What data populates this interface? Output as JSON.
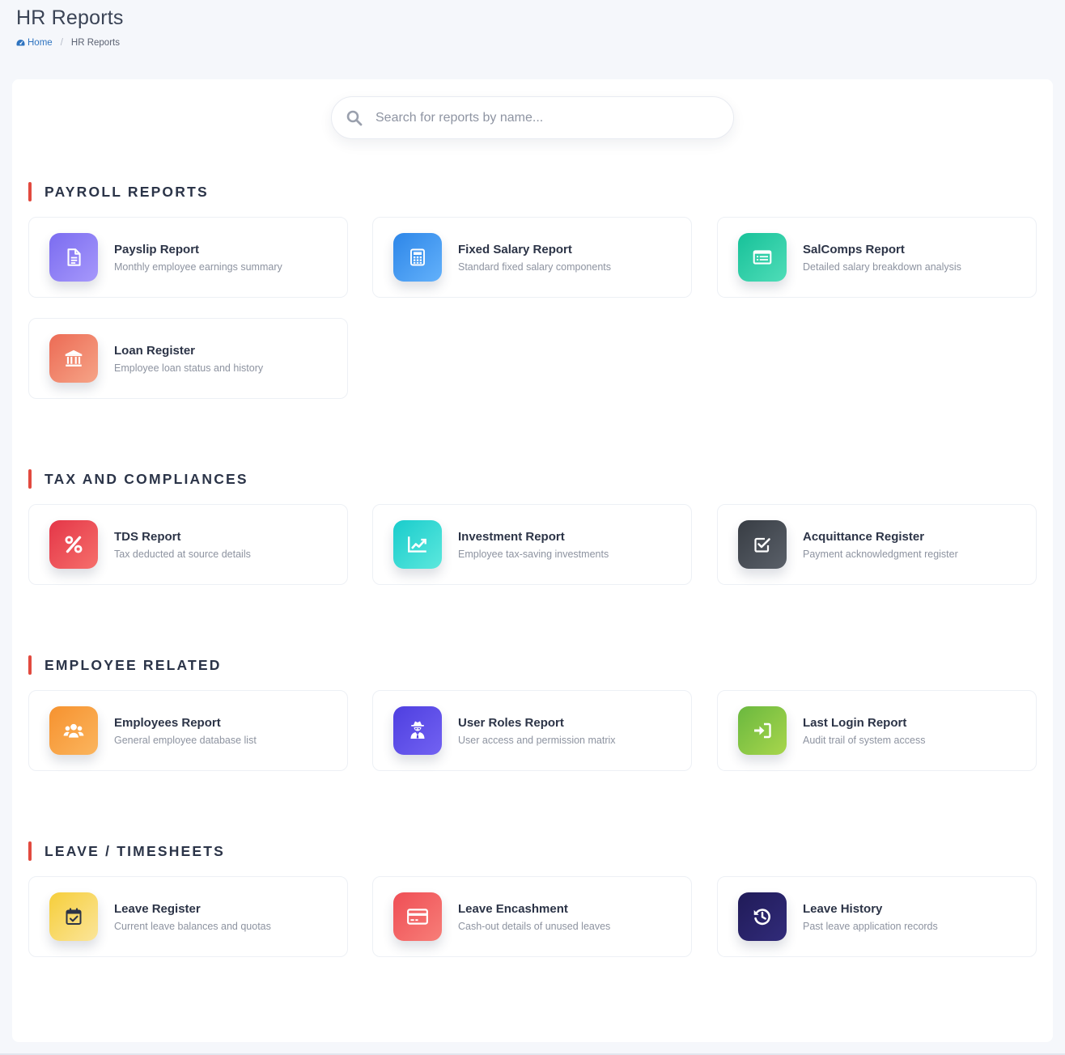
{
  "page": {
    "title": "HR Reports",
    "breadcrumb": {
      "home": "Home",
      "separator": "/",
      "current": "HR Reports"
    }
  },
  "search": {
    "placeholder": "Search for reports by name...",
    "value": ""
  },
  "colors": {
    "accent": "#e24a3f",
    "link": "#2f74c0"
  },
  "sections": [
    {
      "title": "PAYROLL REPORTS",
      "cards": [
        {
          "title": "Payslip Report",
          "desc": "Monthly employee earnings summary",
          "icon": "file-icon",
          "gradient": [
            "#7b6cf0",
            "#a698fb"
          ]
        },
        {
          "title": "Fixed Salary Report",
          "desc": "Standard fixed salary components",
          "icon": "calculator-icon",
          "gradient": [
            "#2d86e8",
            "#63b1fb"
          ]
        },
        {
          "title": "SalComps Report",
          "desc": "Detailed salary breakdown analysis",
          "icon": "list-card-icon",
          "gradient": [
            "#17c199",
            "#4fddb8"
          ]
        },
        {
          "title": "Loan Register",
          "desc": "Employee loan status and history",
          "icon": "bank-icon",
          "gradient": [
            "#ec6b55",
            "#f6a487"
          ]
        }
      ]
    },
    {
      "title": "TAX AND COMPLIANCES",
      "cards": [
        {
          "title": "TDS Report",
          "desc": "Tax deducted at source details",
          "icon": "percent-icon",
          "gradient": [
            "#e43648",
            "#f66f6b"
          ]
        },
        {
          "title": "Investment Report",
          "desc": "Employee tax-saving investments",
          "icon": "chart-line-icon",
          "gradient": [
            "#19cccc",
            "#5ce8dd"
          ]
        },
        {
          "title": "Acquittance Register",
          "desc": "Payment acknowledgment register",
          "icon": "check-square-icon",
          "gradient": [
            "#383d44",
            "#5a6069"
          ]
        }
      ]
    },
    {
      "title": "EMPLOYEE RELATED",
      "cards": [
        {
          "title": "Employees Report",
          "desc": "General employee database list",
          "icon": "users-icon",
          "gradient": [
            "#f6922f",
            "#fbb55e"
          ]
        },
        {
          "title": "User Roles Report",
          "desc": "User access and permission matrix",
          "icon": "user-secret-icon",
          "gradient": [
            "#4e3fe0",
            "#7262f2"
          ]
        },
        {
          "title": "Last Login Report",
          "desc": "Audit trail of system access",
          "icon": "sign-in-icon",
          "gradient": [
            "#6ab83f",
            "#a8d64c"
          ]
        }
      ]
    },
    {
      "title": "LEAVE / TIMESHEETS",
      "cards": [
        {
          "title": "Leave Register",
          "desc": "Current leave balances and quotas",
          "icon": "calendar-check-icon",
          "gradient": [
            "#f6ce3a",
            "#fbe59a"
          ]
        },
        {
          "title": "Leave Encashment",
          "desc": "Cash-out details of unused leaves",
          "icon": "credit-card-icon",
          "gradient": [
            "#ef4e55",
            "#f77e78"
          ]
        },
        {
          "title": "Leave History",
          "desc": "Past leave application records",
          "icon": "history-icon",
          "gradient": [
            "#201b58",
            "#312b7a"
          ]
        }
      ]
    }
  ]
}
